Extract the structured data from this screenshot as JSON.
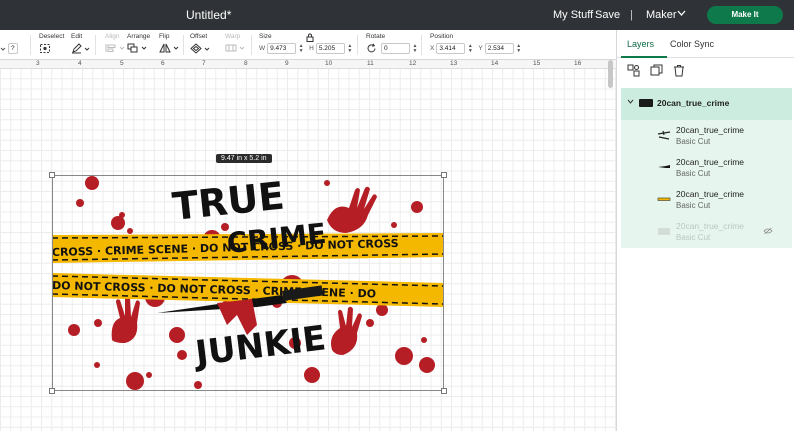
{
  "topbar": {
    "title": "Untitled*",
    "my_stuff": "My Stuff",
    "save": "Save",
    "separator": "|",
    "machine": "Maker",
    "make_it": "Make It"
  },
  "toolbar": {
    "deselect": "Deselect",
    "edit": "Edit",
    "align": "Align",
    "arrange": "Arrange",
    "flip": "Flip",
    "offset": "Offset",
    "warp": "Warp",
    "size": "Size",
    "size_w_label": "W",
    "size_w": "9.473",
    "size_h_label": "H",
    "size_h": "5.205",
    "rotate": "Rotate",
    "rotate_value": "0",
    "position": "Position",
    "pos_x_label": "X",
    "pos_x": "3.414",
    "pos_y_label": "Y",
    "pos_y": "2.534",
    "help": "?"
  },
  "canvas": {
    "ruler_ticks": [
      "3",
      "4",
      "5",
      "6",
      "7",
      "8",
      "9",
      "10",
      "11",
      "12",
      "13",
      "14",
      "15",
      "16"
    ],
    "dimension_label": "9.47  in x 5.2  in"
  },
  "design": {
    "word_true": "TRUE",
    "word_crime": "CRIME",
    "word_junkie": "JUNKIE",
    "tape_top": "CROSS · CRIME SCENE · DO NOT CROSS · DO NOT CROSS",
    "tape_bottom": "DO NOT CROSS · DO NOT CROSS · CRIME SCENE · DO",
    "colors": {
      "tape": "#f5b800",
      "blood": "#b51e24",
      "ink": "#111111"
    }
  },
  "panel": {
    "tab_layers": "Layers",
    "tab_color_sync": "Color Sync",
    "group_name": "20can_true_crime",
    "layers": [
      {
        "name": "20can_true_crime",
        "type": "Basic Cut"
      },
      {
        "name": "20can_true_crime",
        "type": "Basic Cut"
      },
      {
        "name": "20can_true_crime",
        "type": "Basic Cut"
      },
      {
        "name": "20can_true_crime",
        "type": "Basic Cut"
      }
    ]
  }
}
